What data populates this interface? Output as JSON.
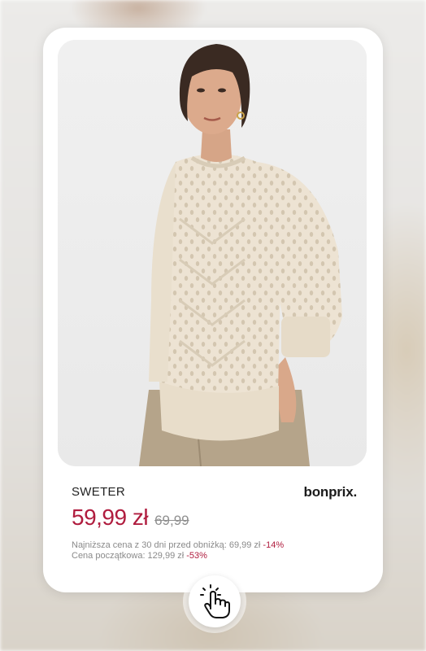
{
  "product": {
    "name": "SWETER",
    "brand": "bonprix.",
    "price": "59,99 zł",
    "old_price": "69,99",
    "lowest_price_label": "Najniższa cena z 30 dni  przed obniżką: 69,99 zł",
    "lowest_price_pct": "-14%",
    "initial_price_label": "Cena początkowa: 129,99 zł",
    "initial_price_pct": "-53%"
  },
  "icons": {
    "tap": "tap-hand-icon"
  },
  "colors": {
    "price": "#b01d3f",
    "sweater": "#ece2d2",
    "trousers": "#b5a48a"
  }
}
